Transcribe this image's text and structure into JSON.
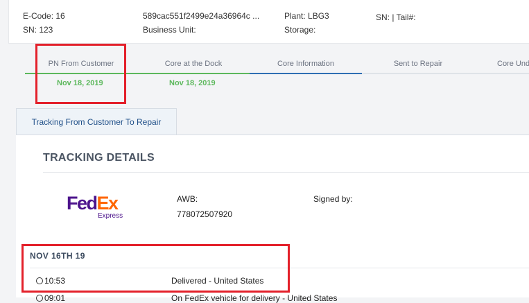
{
  "header": {
    "ecode": "E-Code: 16",
    "sn": "SN: 123",
    "hash": "589cac551f2499e24a36964c ...",
    "business_unit": "Business Unit:",
    "plant": "Plant: LBG3",
    "storage": "Storage:",
    "sn_tail": "SN: | Tail#:"
  },
  "steps": [
    {
      "label": "PN From Customer",
      "date": "Nov 18, 2019",
      "status": "complete"
    },
    {
      "label": "Core at the Dock",
      "date": "Nov 18, 2019",
      "status": "complete"
    },
    {
      "label": "Core Information",
      "date": "",
      "status": "active"
    },
    {
      "label": "Sent to Repair",
      "date": "",
      "status": "pending"
    },
    {
      "label": "Core Und",
      "date": "",
      "status": "pending"
    }
  ],
  "tabs": {
    "tracking": "Tracking From Customer To Repair"
  },
  "tracking": {
    "title": "TRACKING DETAILS",
    "carrier_logo": {
      "fed": "Fed",
      "ex": "Ex",
      "sub": "Express"
    },
    "awb_label": "AWB:",
    "awb_value": "778072507920",
    "signed_by_label": "Signed by:",
    "groups": [
      {
        "date": "NOV 16TH 19",
        "events": [
          {
            "time": "10:53",
            "description": "Delivered - United States"
          },
          {
            "time": "09:01",
            "description": "On FedEx vehicle for delivery - United States"
          }
        ]
      }
    ]
  },
  "colors": {
    "complete": "#5cb85c",
    "active": "#2f6fb3",
    "highlight": "#e3202a",
    "fedex_purple": "#4d148c",
    "fedex_orange": "#ff6600"
  },
  "icons": [
    "clock-icon"
  ]
}
